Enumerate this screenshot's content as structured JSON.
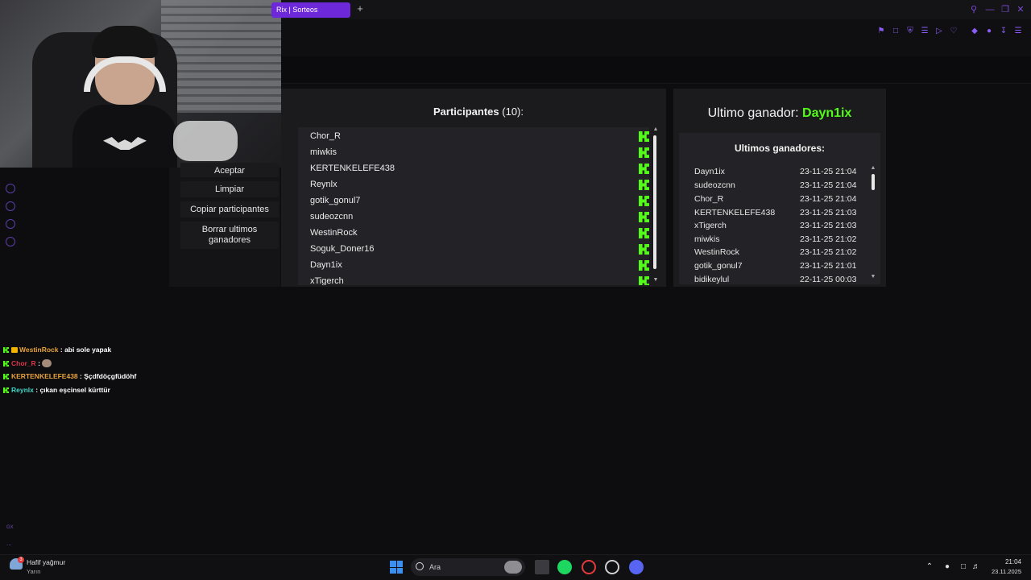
{
  "browser": {
    "active_tab_title": "Rix | Sorteos",
    "new_tab_label": "+"
  },
  "sidebar": {
    "buttons": [
      "Aceptar",
      "Limpiar",
      "Copiar participantes",
      "Borrar ultimos ganadores"
    ]
  },
  "participants": {
    "title": "Participantes",
    "count": "(10):",
    "names": [
      "Chor_R",
      "miwkis",
      "KERTENKELEFE438",
      "Reynlx",
      "gotik_gonul7",
      "sudeozcnn",
      "WestinRock",
      "Soguk_Doner16",
      "Dayn1ix",
      "xTigerch"
    ]
  },
  "winner": {
    "label": "Ultimo ganador:",
    "name": "Dayn1ix"
  },
  "winners_list": {
    "title": "Ultimos ganadores:",
    "rows": [
      {
        "name": "Dayn1ix",
        "date": "23-11-25 21:04"
      },
      {
        "name": "sudeozcnn",
        "date": "23-11-25 21:04"
      },
      {
        "name": "Chor_R",
        "date": "23-11-25 21:04"
      },
      {
        "name": "KERTENKELEFE438",
        "date": "23-11-25 21:03"
      },
      {
        "name": "xTigerch",
        "date": "23-11-25 21:03"
      },
      {
        "name": "miwkis",
        "date": "23-11-25 21:02"
      },
      {
        "name": "WestinRock",
        "date": "23-11-25 21:02"
      },
      {
        "name": "gotik_gonul7",
        "date": "23-11-25 21:01"
      },
      {
        "name": "bidikeylul",
        "date": "22-11-25 00:03"
      }
    ]
  },
  "chat": [
    {
      "user": "WestinRock",
      "color": "#e8a33d",
      "message": ": abi sole yapak"
    },
    {
      "user": "Chor_R",
      "color": "#d9364b",
      "message": ":"
    },
    {
      "user": "KERTENKELEFE438",
      "color": "#e8a33d",
      "message": ": Şçdfdöçgfüdöhf"
    },
    {
      "user": "Reynlx",
      "color": "#3fd6c5",
      "message": ": çıkan eşcinsel kürttür"
    }
  ],
  "taskbar": {
    "weather": "Hafif yağmur",
    "weather_sub": "Yarın",
    "weather_badge": "3",
    "search_placeholder": "Ara",
    "time": "21:04",
    "date": "23.11.2025"
  },
  "rail": {
    "gx_label": "GX",
    "more_label": "..."
  },
  "colors": {
    "kick_green": "#53fc18",
    "accent_purple": "#6d28d9"
  }
}
